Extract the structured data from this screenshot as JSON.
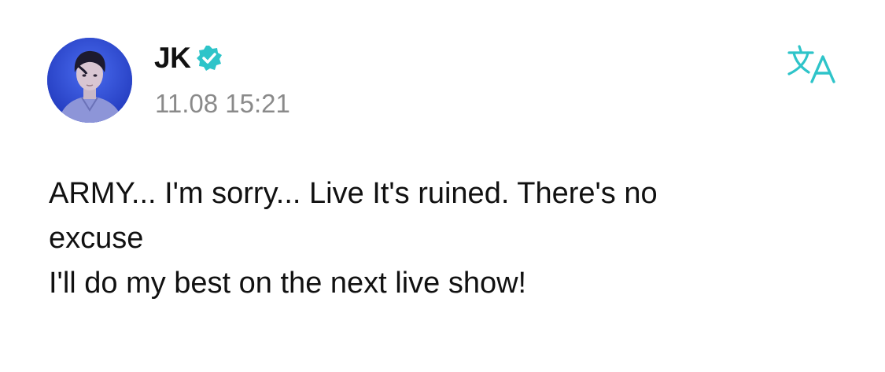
{
  "author": {
    "name": "JK",
    "verified_icon": "verified-badge-icon",
    "avatar_icon": "profile-photo"
  },
  "post": {
    "timestamp": "11.08 15:21",
    "lines": [
      "ARMY... I'm sorry... Live It's ruined. There's no",
      "excuse",
      "I'll do my best on the next live show!"
    ]
  },
  "actions": {
    "translate_icon": "translate-icon"
  },
  "colors": {
    "accent": "#2ec4c9",
    "timestamp": "#8a8a8a",
    "text": "#111111",
    "avatar_bg": "#2f4fd6"
  }
}
